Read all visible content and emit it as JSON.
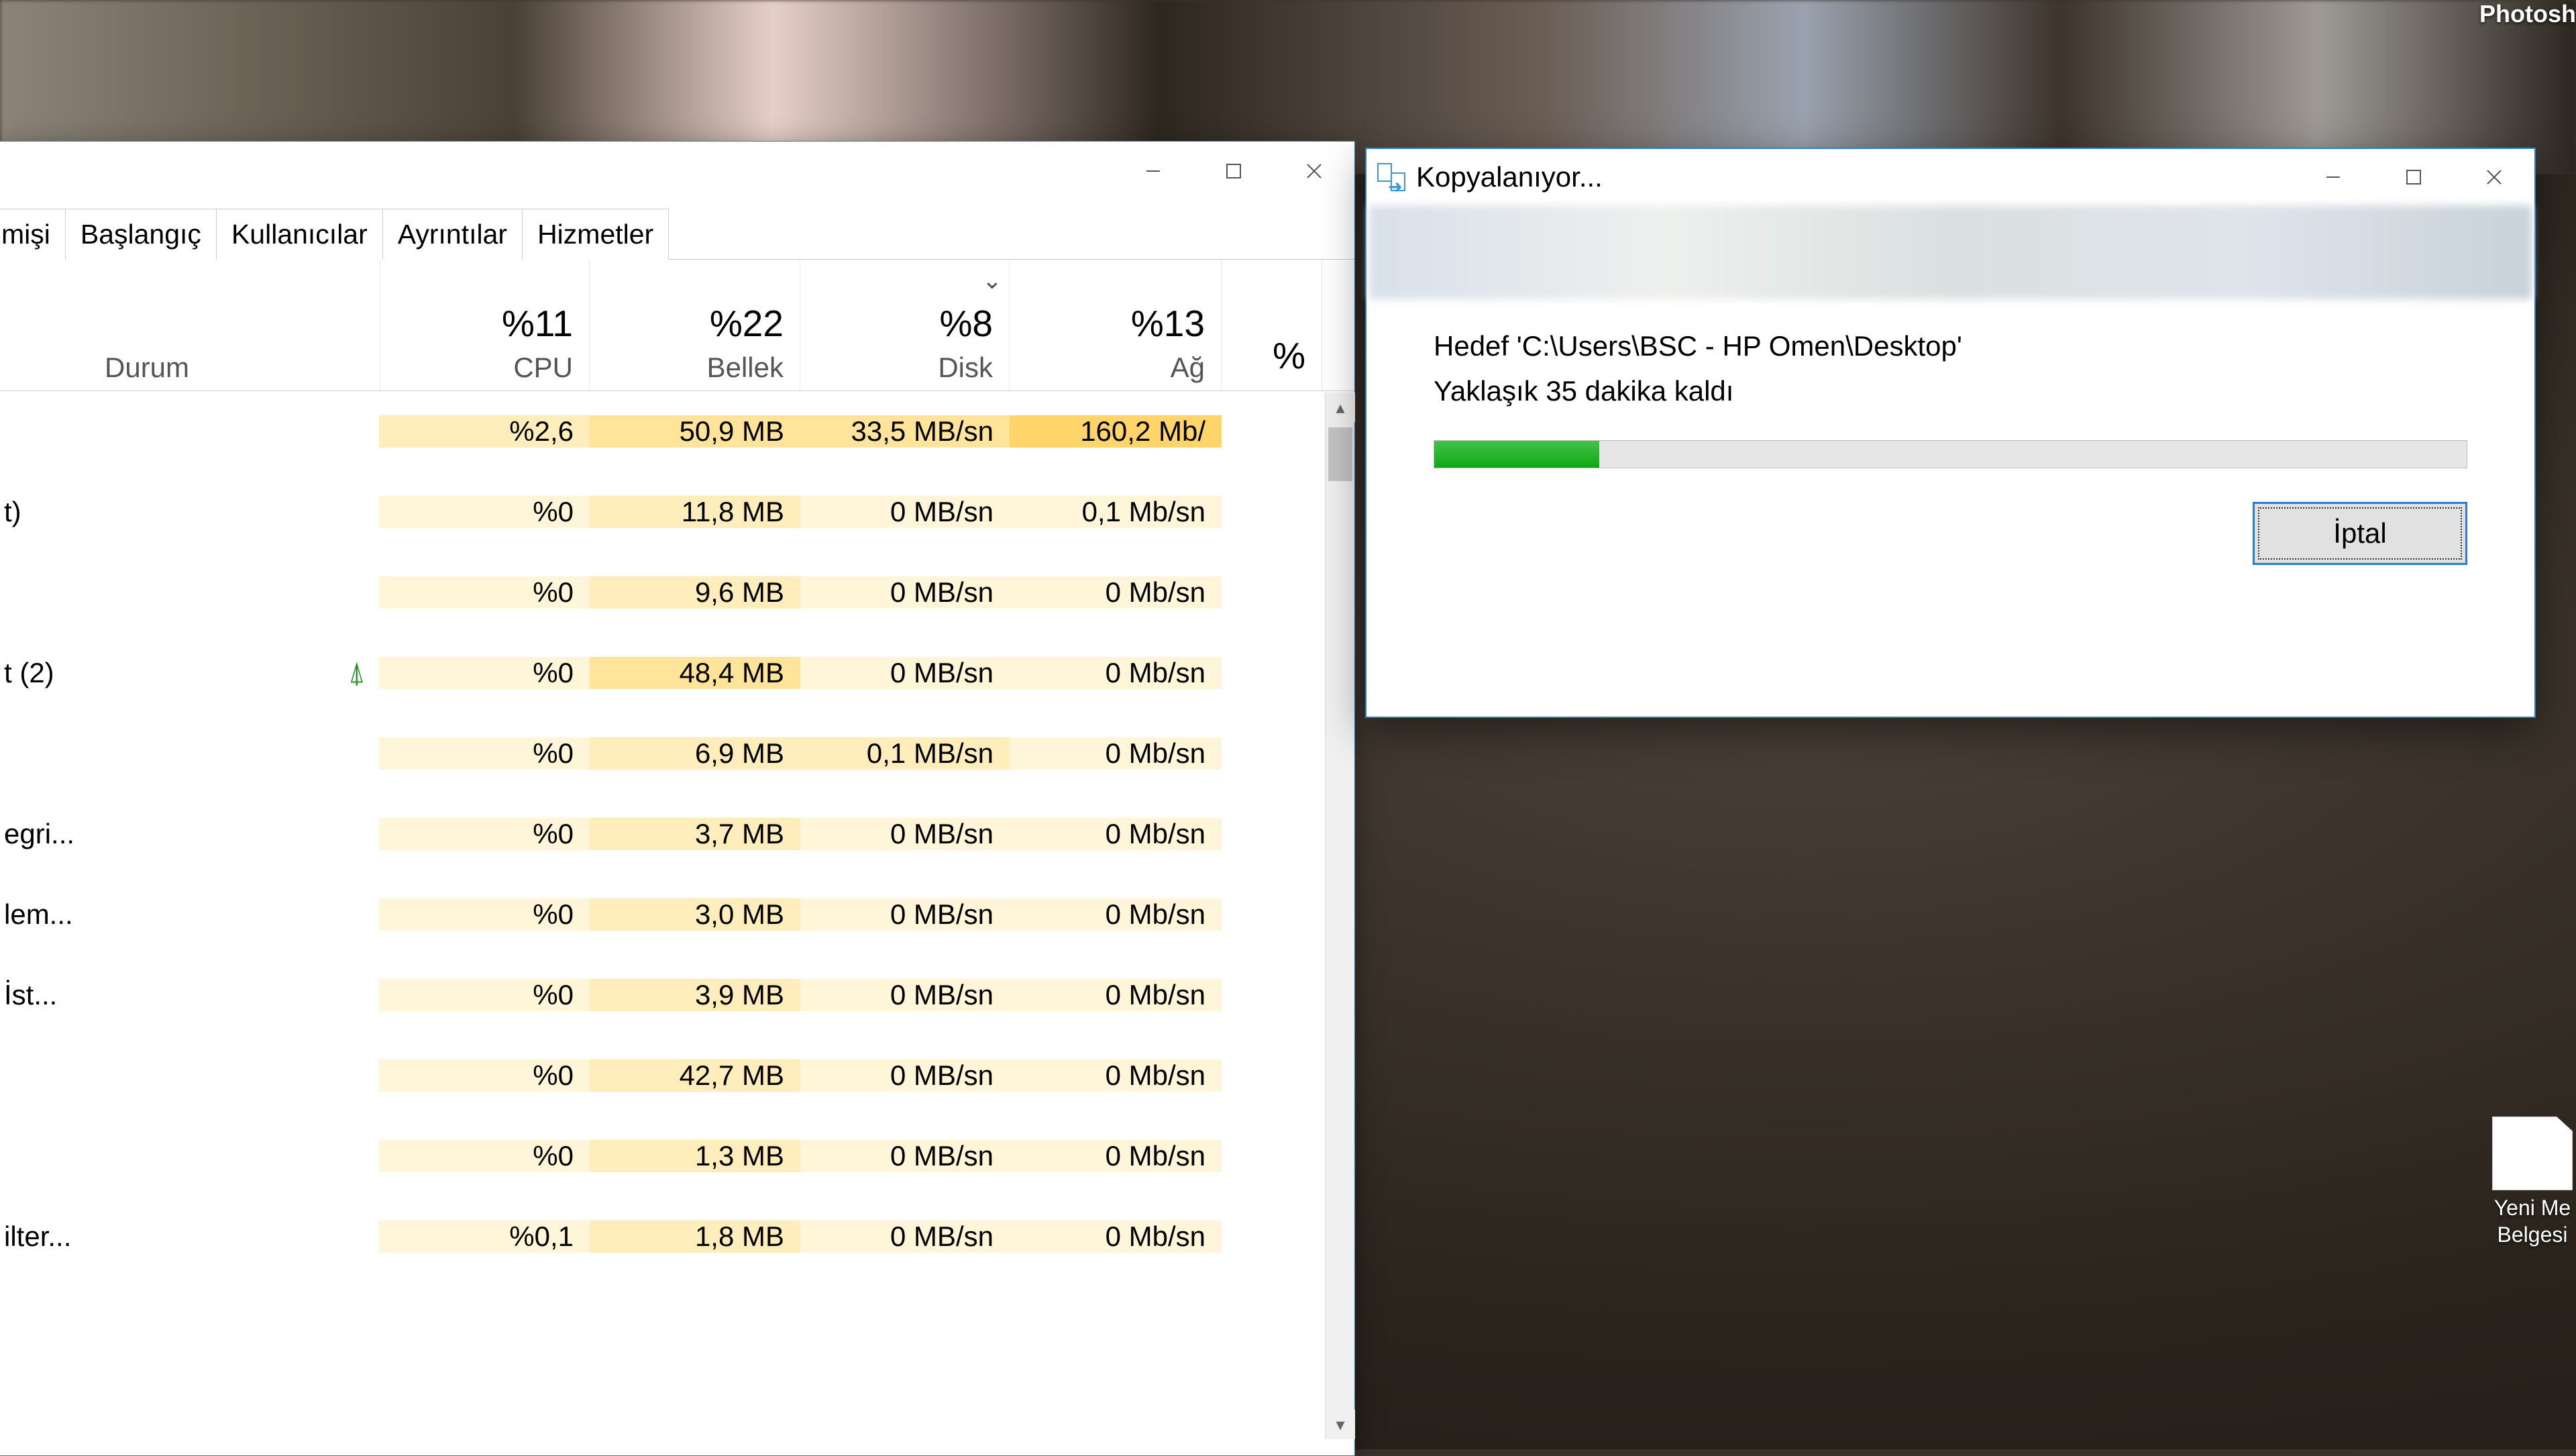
{
  "taskmgr": {
    "tabs": [
      "mişi",
      "Başlangıç",
      "Kullanıcılar",
      "Ayrıntılar",
      "Hizmetler"
    ],
    "durum_label": "Durum",
    "columns": [
      {
        "pct": "%11",
        "label": "CPU"
      },
      {
        "pct": "%22",
        "label": "Bellek"
      },
      {
        "pct": "%8",
        "label": "Disk"
      },
      {
        "pct": "%13",
        "label": "Ağ"
      },
      {
        "pct": "%",
        "label": ""
      }
    ],
    "rows": [
      {
        "name": "",
        "leaf": false,
        "cpu": "%2,6",
        "mem": "50,9 MB",
        "disk": "33,5 MB/sn",
        "net": "160,2 Mb/"
      },
      {
        "name": "t)",
        "leaf": false,
        "cpu": "%0",
        "mem": "11,8 MB",
        "disk": "0 MB/sn",
        "net": "0,1 Mb/sn"
      },
      {
        "name": "",
        "leaf": false,
        "cpu": "%0",
        "mem": "9,6 MB",
        "disk": "0 MB/sn",
        "net": "0 Mb/sn"
      },
      {
        "name": "t (2)",
        "leaf": true,
        "cpu": "%0",
        "mem": "48,4 MB",
        "disk": "0 MB/sn",
        "net": "0 Mb/sn"
      },
      {
        "name": "",
        "leaf": false,
        "cpu": "%0",
        "mem": "6,9 MB",
        "disk": "0,1 MB/sn",
        "net": "0 Mb/sn"
      },
      {
        "name": "egri...",
        "leaf": false,
        "cpu": "%0",
        "mem": "3,7 MB",
        "disk": "0 MB/sn",
        "net": "0 Mb/sn"
      },
      {
        "name": "lem...",
        "leaf": false,
        "cpu": "%0",
        "mem": "3,0 MB",
        "disk": "0 MB/sn",
        "net": "0 Mb/sn"
      },
      {
        "name": "İst...",
        "leaf": false,
        "cpu": "%0",
        "mem": "3,9 MB",
        "disk": "0 MB/sn",
        "net": "0 Mb/sn"
      },
      {
        "name": "",
        "leaf": false,
        "cpu": "%0",
        "mem": "42,7 MB",
        "disk": "0 MB/sn",
        "net": "0 Mb/sn"
      },
      {
        "name": "",
        "leaf": false,
        "cpu": "%0",
        "mem": "1,3 MB",
        "disk": "0 MB/sn",
        "net": "0 Mb/sn"
      },
      {
        "name": "ilter...",
        "leaf": false,
        "cpu": "%0,1",
        "mem": "1,8 MB",
        "disk": "0 MB/sn",
        "net": "0 Mb/sn"
      }
    ]
  },
  "copy": {
    "title": "Kopyalanıyor...",
    "dest": "Hedef 'C:\\Users\\BSC - HP Omen\\Desktop'",
    "remaining": "Yaklaşık 35 dakika kaldı",
    "cancel": "İptal",
    "progress_pct": 16
  },
  "desktop": {
    "photoshop": "Photosh",
    "text_doc": "Yeni Me\nBelgesi"
  }
}
